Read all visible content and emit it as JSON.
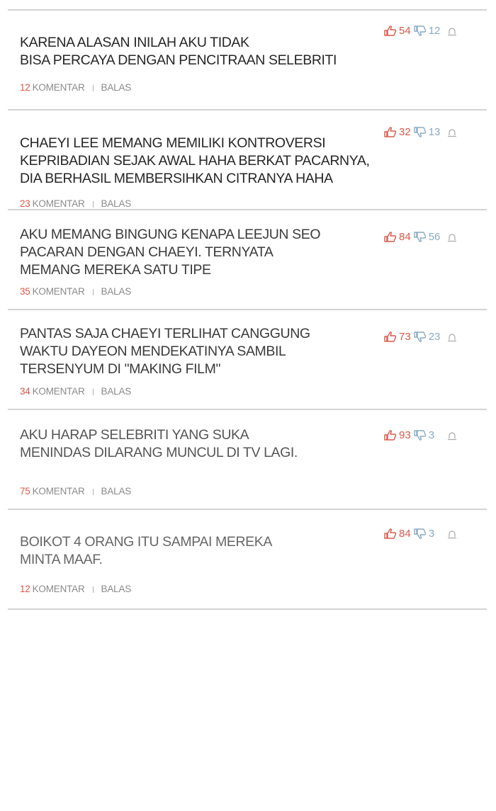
{
  "comments": [
    {
      "text": "Karena alasan inilah aku tidak\nbisa percaya dengan pencitraan selebriti",
      "comment_count": "12",
      "comment_label": "KOMENTAR",
      "reply_label": "BALAS",
      "likes": "54",
      "dislikes": "12"
    },
    {
      "text": "Chaeyi Lee memang memiliki kontroversi\nkepribadian sejak awal haha berkat pacarnya,\ndia berhasil membersihkan citranya haha",
      "comment_count": "23",
      "comment_label": "KOMENTAR",
      "reply_label": "BALAS",
      "likes": "32",
      "dislikes": "13"
    },
    {
      "text": "Aku memang bingung kenapa Leejun Seo\npacaran dengan Chaeyi. Ternyata\nmemang mereka satu tipe",
      "comment_count": "35",
      "comment_label": "KOMENTAR",
      "reply_label": "BALAS",
      "likes": "84",
      "dislikes": "56"
    },
    {
      "text": "Pantas saja Chaeyi terlihat canggung\nwaktu Dayeon mendekatinya sambil\ntersenyum di \"making film\"",
      "comment_count": "34",
      "comment_label": "KOMENTAR",
      "reply_label": "BALAS",
      "likes": "73",
      "dislikes": "23"
    },
    {
      "text": "Aku harap selebriti yang suka\nmenindas dilarang muncul di TV lagi.",
      "comment_count": "75",
      "comment_label": "KOMENTAR",
      "reply_label": "BALAS",
      "likes": "93",
      "dislikes": "3"
    },
    {
      "text": "Boikot 4 orang itu sampai mereka\nminta maaf.",
      "comment_count": "12",
      "comment_label": "KOMENTAR",
      "reply_label": "BALAS",
      "likes": "84",
      "dislikes": "3"
    }
  ],
  "colors": {
    "accent_red": "#d9584a",
    "dislike_blue": "#88aac2",
    "divider": "#d4d4d4",
    "meta_gray": "#8a8a8a"
  },
  "icons": {
    "like": "thumbs-up-icon",
    "dislike": "thumbs-down-icon",
    "report": "report-icon"
  }
}
